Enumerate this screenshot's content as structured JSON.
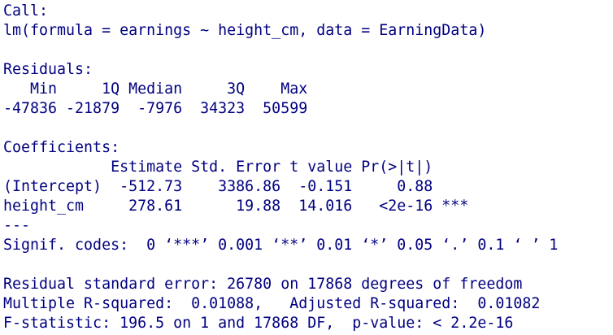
{
  "console": {
    "lines": [
      "Call:",
      "lm(formula = earnings ~ height_cm, data = EarningData)",
      "",
      "Residuals:",
      "   Min     1Q Median     3Q    Max ",
      "-47836 -21879  -7976  34323  50599 ",
      "",
      "Coefficients:",
      "            Estimate Std. Error t value Pr(>|t|)    ",
      "(Intercept)  -512.73    3386.86  -0.151     0.88    ",
      "height_cm     278.61      19.88  14.016   <2e-16 ***",
      "---",
      "Signif. codes:  0 ‘***’ 0.001 ‘**’ 0.01 ‘*’ 0.05 ‘.’ 0.1 ‘ ’ 1",
      "",
      "Residual standard error: 26780 on 17868 degrees of freedom",
      "Multiple R-squared:  0.01088,\tAdjusted R-squared:  0.01082 ",
      "F-statistic: 196.5 on 1 and 17868 DF,  p-value: < 2.2e-16"
    ]
  },
  "colors": {
    "background": "#ffffff",
    "text": "#000080"
  }
}
